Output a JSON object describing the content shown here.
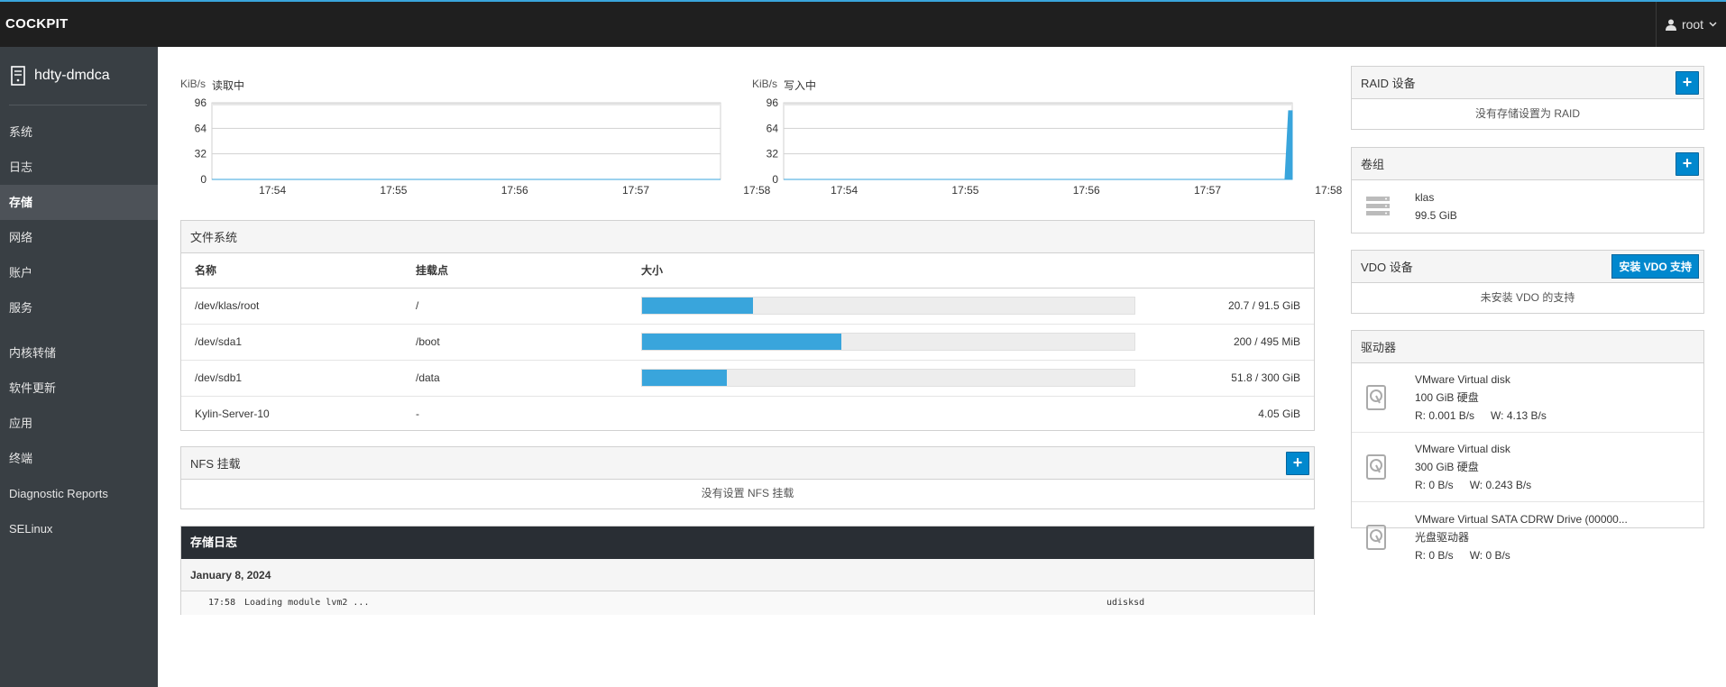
{
  "header": {
    "brand": "COCKPIT",
    "user": "root"
  },
  "sidebar": {
    "hostname": "hdty-dmdca",
    "items_a": [
      {
        "label": "系统",
        "active": false
      },
      {
        "label": "日志",
        "active": false
      },
      {
        "label": "存储",
        "active": true
      },
      {
        "label": "网络",
        "active": false
      },
      {
        "label": "账户",
        "active": false
      },
      {
        "label": "服务",
        "active": false
      }
    ],
    "items_b": [
      {
        "label": "内核转储"
      },
      {
        "label": "软件更新"
      },
      {
        "label": "应用"
      },
      {
        "label": "终端"
      },
      {
        "label": "Diagnostic Reports"
      },
      {
        "label": "SELinux"
      }
    ]
  },
  "chart_data": [
    {
      "type": "line",
      "title": "读取中",
      "ylabel": "KiB/s",
      "ylim": [
        0,
        96
      ],
      "yticks": [
        "96",
        "64",
        "32",
        "0"
      ],
      "xticks": [
        "17:54",
        "17:55",
        "17:56",
        "17:57",
        "17:58"
      ],
      "series": [
        {
          "x": [
            0,
            1,
            2,
            3,
            4,
            4.2
          ],
          "values": [
            0,
            0,
            0,
            0,
            0,
            0
          ]
        }
      ],
      "color": "#39a5dc"
    },
    {
      "type": "area",
      "title": "写入中",
      "ylabel": "KiB/s",
      "ylim": [
        0,
        96
      ],
      "yticks": [
        "96",
        "64",
        "32",
        "0"
      ],
      "xticks": [
        "17:54",
        "17:55",
        "17:56",
        "17:57",
        "17:58"
      ],
      "series": [
        {
          "x": [
            0,
            1,
            2,
            3,
            4,
            4.14,
            4.17,
            4.2
          ],
          "values": [
            0,
            0,
            0,
            0,
            0,
            0,
            86,
            86
          ]
        }
      ],
      "color": "#39a5dc"
    }
  ],
  "filesystems": {
    "title": "文件系统",
    "columns": {
      "name": "名称",
      "mount": "挂载点",
      "size": "大小"
    },
    "rows": [
      {
        "name": "/dev/klas/root",
        "mount": "/",
        "usage": 0.226,
        "size": "20.7 / 91.5 GiB"
      },
      {
        "name": "/dev/sda1",
        "mount": "/boot",
        "usage": 0.404,
        "size": "200 / 495 MiB"
      },
      {
        "name": "/dev/sdb1",
        "mount": "/data",
        "usage": 0.172,
        "size": "51.8 / 300 GiB"
      },
      {
        "name": "Kylin-Server-10",
        "mount": "-",
        "usage": null,
        "size": "4.05 GiB"
      }
    ]
  },
  "nfs": {
    "title": "NFS 挂载",
    "empty": "没有设置 NFS 挂载"
  },
  "storage_log": {
    "title": "存储日志",
    "date": "January 8, 2024",
    "entries": [
      {
        "time": "17:58",
        "message": "Loading module lvm2 ...",
        "source": "udisksd"
      }
    ]
  },
  "raid": {
    "title": "RAID 设备",
    "empty": "没有存储设置为 RAID"
  },
  "volume_groups": {
    "title": "卷组",
    "items": [
      {
        "name": "klas",
        "size": "99.5 GiB"
      }
    ]
  },
  "vdo": {
    "title": "VDO 设备",
    "install_button": "安装 VDO 支持",
    "empty": "未安装 VDO 的支持"
  },
  "drives": {
    "title": "驱动器",
    "items": [
      {
        "name": "VMware Virtual disk",
        "kind": "100 GiB 硬盘",
        "read": "R: 0.001 B/s",
        "write": "W: 4.13 B/s"
      },
      {
        "name": "VMware Virtual disk",
        "kind": "300 GiB 硬盘",
        "read": "R: 0 B/s",
        "write": "W: 0.243 B/s"
      },
      {
        "name": "VMware Virtual SATA CDRW Drive (00000...",
        "kind": "光盘驱动器",
        "read": "R: 0 B/s",
        "write": "W: 0 B/s"
      }
    ]
  }
}
